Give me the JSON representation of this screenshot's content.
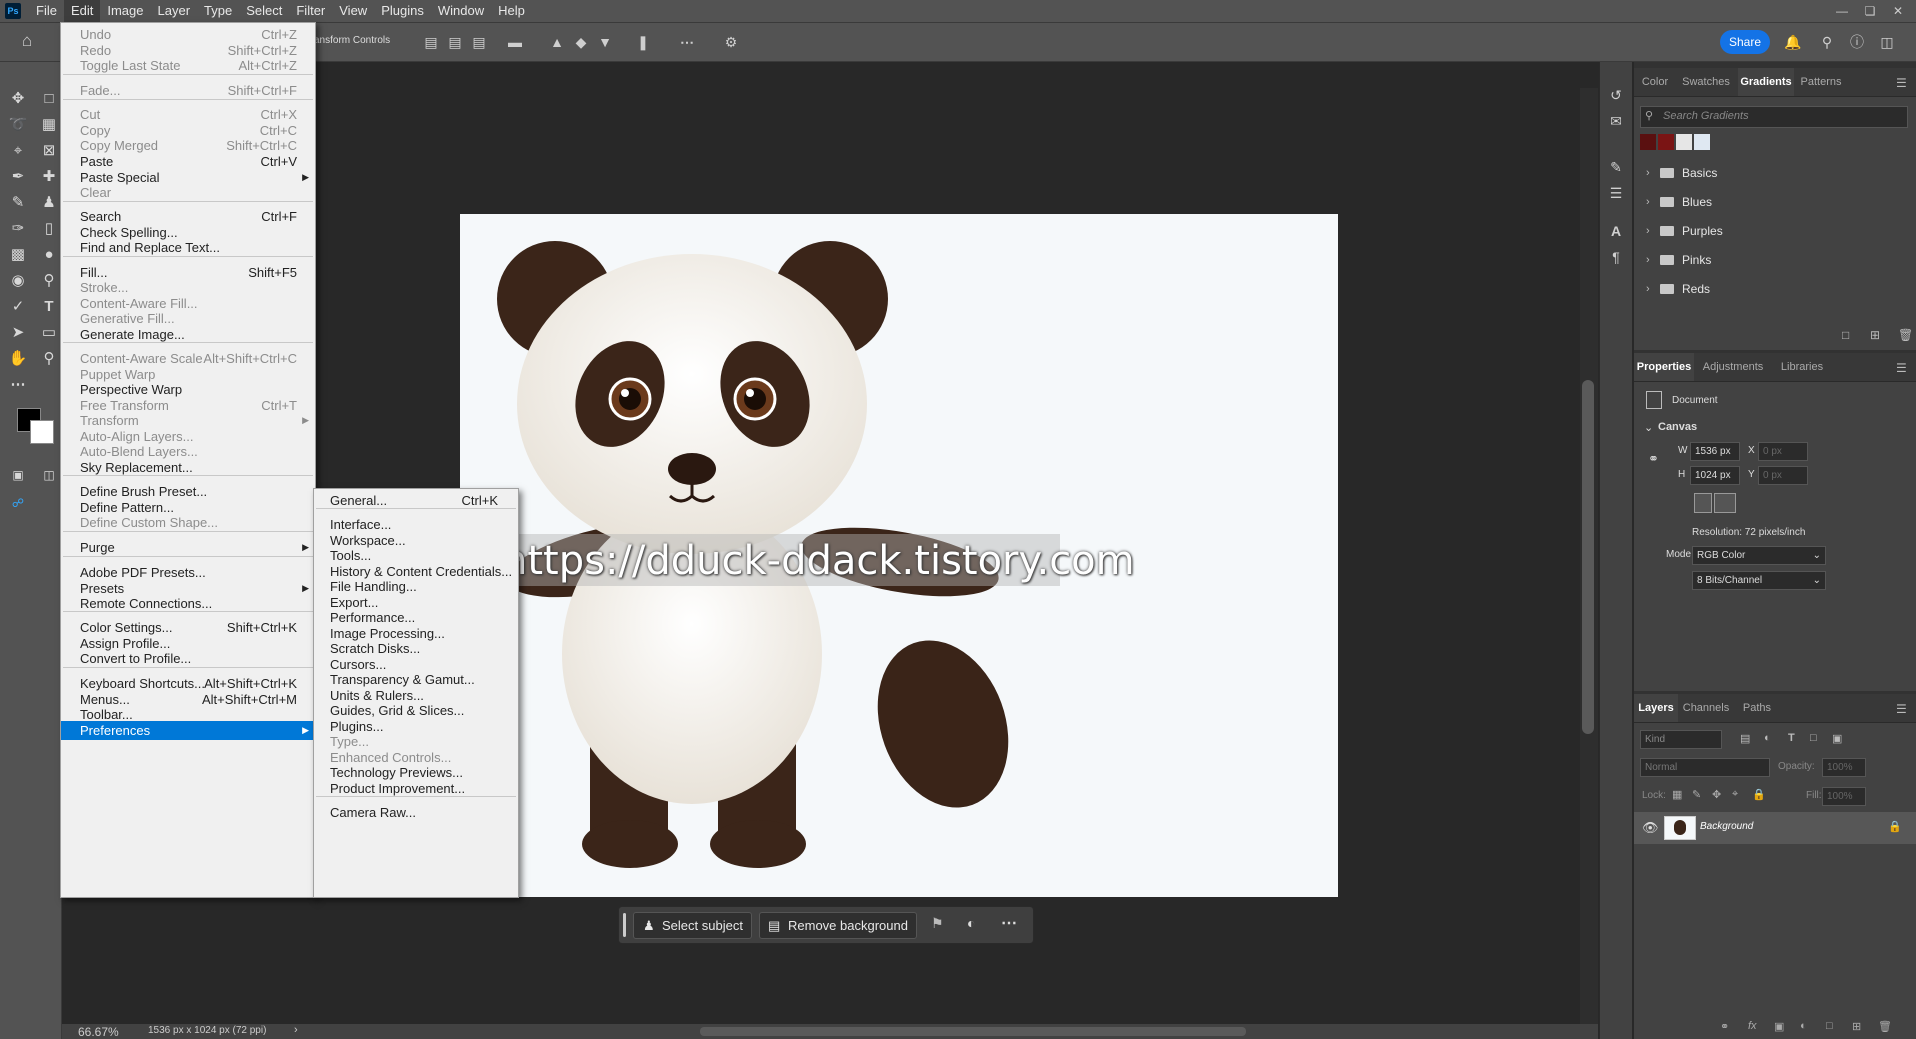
{
  "app": {
    "logo": "Ps"
  },
  "menubar": {
    "items": [
      "File",
      "Edit",
      "Image",
      "Layer",
      "Type",
      "Select",
      "Filter",
      "View",
      "Plugins",
      "Window",
      "Help"
    ],
    "active": "Edit"
  },
  "options_bar": {
    "transform_controls_label": "ansform Controls",
    "share_label": "Share"
  },
  "edit_menu": {
    "items": [
      {
        "label": "Undo",
        "shortcut": "Ctrl+Z",
        "disabled": true
      },
      {
        "label": "Redo",
        "shortcut": "Shift+Ctrl+Z",
        "disabled": true
      },
      {
        "label": "Toggle Last State",
        "shortcut": "Alt+Ctrl+Z",
        "disabled": true
      },
      {
        "label": "Fade...",
        "shortcut": "Shift+Ctrl+F",
        "disabled": true
      },
      {
        "label": "Cut",
        "shortcut": "Ctrl+X",
        "disabled": true
      },
      {
        "label": "Copy",
        "shortcut": "Ctrl+C",
        "disabled": true
      },
      {
        "label": "Copy Merged",
        "shortcut": "Shift+Ctrl+C",
        "disabled": true
      },
      {
        "label": "Paste",
        "shortcut": "Ctrl+V",
        "disabled": false
      },
      {
        "label": "Paste Special",
        "shortcut": "",
        "disabled": false,
        "submenu": true
      },
      {
        "label": "Clear",
        "shortcut": "",
        "disabled": true
      },
      {
        "label": "Search",
        "shortcut": "Ctrl+F",
        "disabled": false
      },
      {
        "label": "Check Spelling...",
        "shortcut": "",
        "disabled": false
      },
      {
        "label": "Find and Replace Text...",
        "shortcut": "",
        "disabled": false
      },
      {
        "label": "Fill...",
        "shortcut": "Shift+F5",
        "disabled": false
      },
      {
        "label": "Stroke...",
        "shortcut": "",
        "disabled": true
      },
      {
        "label": "Content-Aware Fill...",
        "shortcut": "",
        "disabled": true
      },
      {
        "label": "Generative Fill...",
        "shortcut": "",
        "disabled": true
      },
      {
        "label": "Generate Image...",
        "shortcut": "",
        "disabled": false
      },
      {
        "label": "Content-Aware Scale",
        "shortcut": "Alt+Shift+Ctrl+C",
        "disabled": true
      },
      {
        "label": "Puppet Warp",
        "shortcut": "",
        "disabled": true
      },
      {
        "label": "Perspective Warp",
        "shortcut": "",
        "disabled": false
      },
      {
        "label": "Free Transform",
        "shortcut": "Ctrl+T",
        "disabled": true
      },
      {
        "label": "Transform",
        "shortcut": "",
        "disabled": true,
        "submenu": true
      },
      {
        "label": "Auto-Align Layers...",
        "shortcut": "",
        "disabled": true
      },
      {
        "label": "Auto-Blend Layers...",
        "shortcut": "",
        "disabled": true
      },
      {
        "label": "Sky Replacement...",
        "shortcut": "",
        "disabled": false
      },
      {
        "label": "Define Brush Preset...",
        "shortcut": "",
        "disabled": false
      },
      {
        "label": "Define Pattern...",
        "shortcut": "",
        "disabled": false
      },
      {
        "label": "Define Custom Shape...",
        "shortcut": "",
        "disabled": true
      },
      {
        "label": "Purge",
        "shortcut": "",
        "disabled": false,
        "submenu": true
      },
      {
        "label": "Adobe PDF Presets...",
        "shortcut": "",
        "disabled": false
      },
      {
        "label": "Presets",
        "shortcut": "",
        "disabled": false,
        "submenu": true
      },
      {
        "label": "Remote Connections...",
        "shortcut": "",
        "disabled": false
      },
      {
        "label": "Color Settings...",
        "shortcut": "Shift+Ctrl+K",
        "disabled": false
      },
      {
        "label": "Assign Profile...",
        "shortcut": "",
        "disabled": false
      },
      {
        "label": "Convert to Profile...",
        "shortcut": "",
        "disabled": false
      },
      {
        "label": "Keyboard Shortcuts...",
        "shortcut": "Alt+Shift+Ctrl+K",
        "disabled": false
      },
      {
        "label": "Menus...",
        "shortcut": "Alt+Shift+Ctrl+M",
        "disabled": false
      },
      {
        "label": "Toolbar...",
        "shortcut": "",
        "disabled": false
      },
      {
        "label": "Preferences",
        "shortcut": "",
        "disabled": false,
        "submenu": true,
        "highlighted": true
      }
    ]
  },
  "preferences_submenu": {
    "items": [
      {
        "label": "General...",
        "shortcut": "Ctrl+K",
        "disabled": false
      },
      {
        "label": "Interface...",
        "disabled": false
      },
      {
        "label": "Workspace...",
        "disabled": false
      },
      {
        "label": "Tools...",
        "disabled": false
      },
      {
        "label": "History & Content Credentials...",
        "disabled": false
      },
      {
        "label": "File Handling...",
        "disabled": false
      },
      {
        "label": "Export...",
        "disabled": false
      },
      {
        "label": "Performance...",
        "disabled": false
      },
      {
        "label": "Image Processing...",
        "disabled": false
      },
      {
        "label": "Scratch Disks...",
        "disabled": false
      },
      {
        "label": "Cursors...",
        "disabled": false
      },
      {
        "label": "Transparency & Gamut...",
        "disabled": false
      },
      {
        "label": "Units & Rulers...",
        "disabled": false
      },
      {
        "label": "Guides, Grid & Slices...",
        "disabled": false
      },
      {
        "label": "Plugins...",
        "disabled": false
      },
      {
        "label": "Type...",
        "disabled": true
      },
      {
        "label": "Enhanced Controls...",
        "disabled": true
      },
      {
        "label": "Technology Previews...",
        "disabled": false
      },
      {
        "label": "Product Improvement...",
        "disabled": false
      },
      {
        "label": "Camera Raw...",
        "disabled": false
      }
    ]
  },
  "canvas": {
    "watermark": "https://dduck-ddack.tistory.com"
  },
  "contextual_bar": {
    "select_subject": "Select subject",
    "remove_background": "Remove background"
  },
  "status_bar": {
    "zoom": "66.67%",
    "doc_info": "1536 px x 1024 px (72 ppi)"
  },
  "gradients_panel": {
    "tabs": [
      "Color",
      "Swatches",
      "Gradients",
      "Patterns"
    ],
    "active_tab": "Gradients",
    "search_placeholder": "Search Gradients",
    "swatch_colors": [
      "#5a1010",
      "#7a1414",
      "#e6e6e6",
      "#dfe8f2"
    ],
    "folders": [
      "Basics",
      "Blues",
      "Purples",
      "Pinks",
      "Reds"
    ]
  },
  "properties_panel": {
    "tabs": [
      "Properties",
      "Adjustments",
      "Libraries"
    ],
    "active_tab": "Properties",
    "document_label": "Document",
    "canvas_section": "Canvas",
    "w_label": "W",
    "w_value": "1536 px",
    "h_label": "H",
    "h_value": "1024 px",
    "x_label": "X",
    "x_value": "0 px",
    "y_label": "Y",
    "y_value": "0 px",
    "resolution": "Resolution: 72 pixels/inch",
    "mode_label": "Mode",
    "mode_value": "RGB Color",
    "depth_value": "8 Bits/Channel"
  },
  "layers_panel": {
    "tabs": [
      "Layers",
      "Channels",
      "Paths"
    ],
    "active_tab": "Layers",
    "kind_placeholder": "Kind",
    "blend_mode": "Normal",
    "opacity_label": "Opacity:",
    "opacity_value": "100%",
    "lock_label": "Lock:",
    "fill_label": "Fill:",
    "fill_value": "100%",
    "layer_name": "Background"
  }
}
